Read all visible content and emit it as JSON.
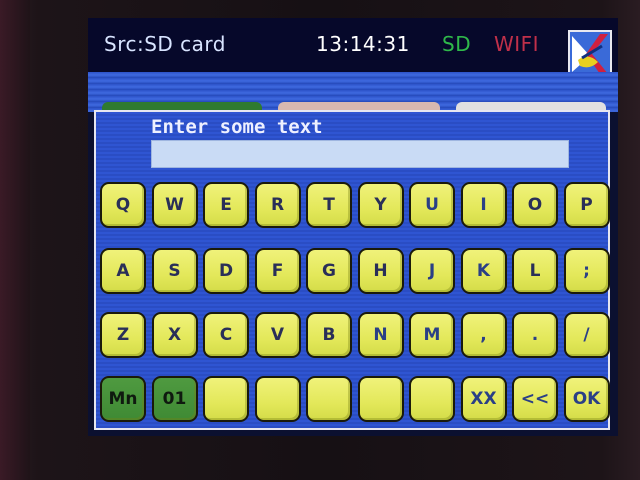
{
  "status": {
    "source": "Src:SD card",
    "time": "13:14:31",
    "sd": "SD",
    "wifi": "WIFI"
  },
  "dialog": {
    "prompt": "Enter some text",
    "input_value": ""
  },
  "keyboard": {
    "row1": [
      "Q",
      "W",
      "E",
      "R",
      "T",
      "Y",
      "U",
      "I",
      "O",
      "P"
    ],
    "row2": [
      "A",
      "S",
      "D",
      "F",
      "G",
      "H",
      "J",
      "K",
      "L",
      ";"
    ],
    "row3": [
      "Z",
      "X",
      "C",
      "V",
      "B",
      "N",
      "M",
      ",",
      ".",
      "/"
    ],
    "row4": [
      "Mn",
      "01",
      "",
      "",
      "",
      "",
      "",
      "XX",
      "<<",
      "OK"
    ]
  },
  "colors": {
    "key": "#e3e85a",
    "mode_key": "#3f8a34",
    "dialog": "#2f55d2",
    "status_sd": "#2fb84a",
    "status_wifi": "#c0304a"
  }
}
